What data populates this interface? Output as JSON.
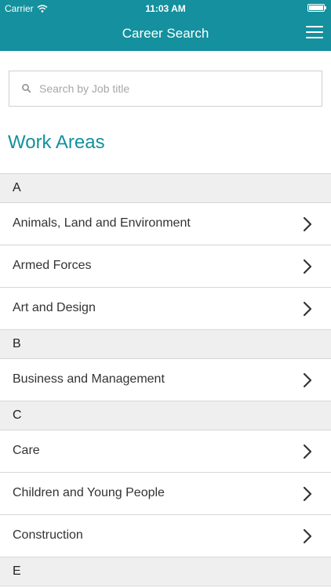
{
  "status_bar": {
    "carrier": "Carrier",
    "time": "11:03 AM"
  },
  "navbar": {
    "title": "Career Search"
  },
  "search": {
    "placeholder": "Search by Job title"
  },
  "page": {
    "heading": "Work Areas"
  },
  "sections": [
    {
      "letter": "A",
      "items": [
        "Animals, Land and Environment",
        "Armed Forces",
        "Art and Design"
      ]
    },
    {
      "letter": "B",
      "items": [
        "Business and Management"
      ]
    },
    {
      "letter": "C",
      "items": [
        "Care",
        "Children and Young People",
        "Construction"
      ]
    },
    {
      "letter": "E",
      "items": []
    }
  ],
  "colors": {
    "accent": "#14909e",
    "section_bg": "#efefef",
    "divider": "#d7d7d7"
  },
  "icons": {
    "wifi": "wifi-icon",
    "battery": "battery-icon",
    "menu": "hamburger-menu-icon",
    "search": "search-icon",
    "chevron": "chevron-right-icon"
  }
}
